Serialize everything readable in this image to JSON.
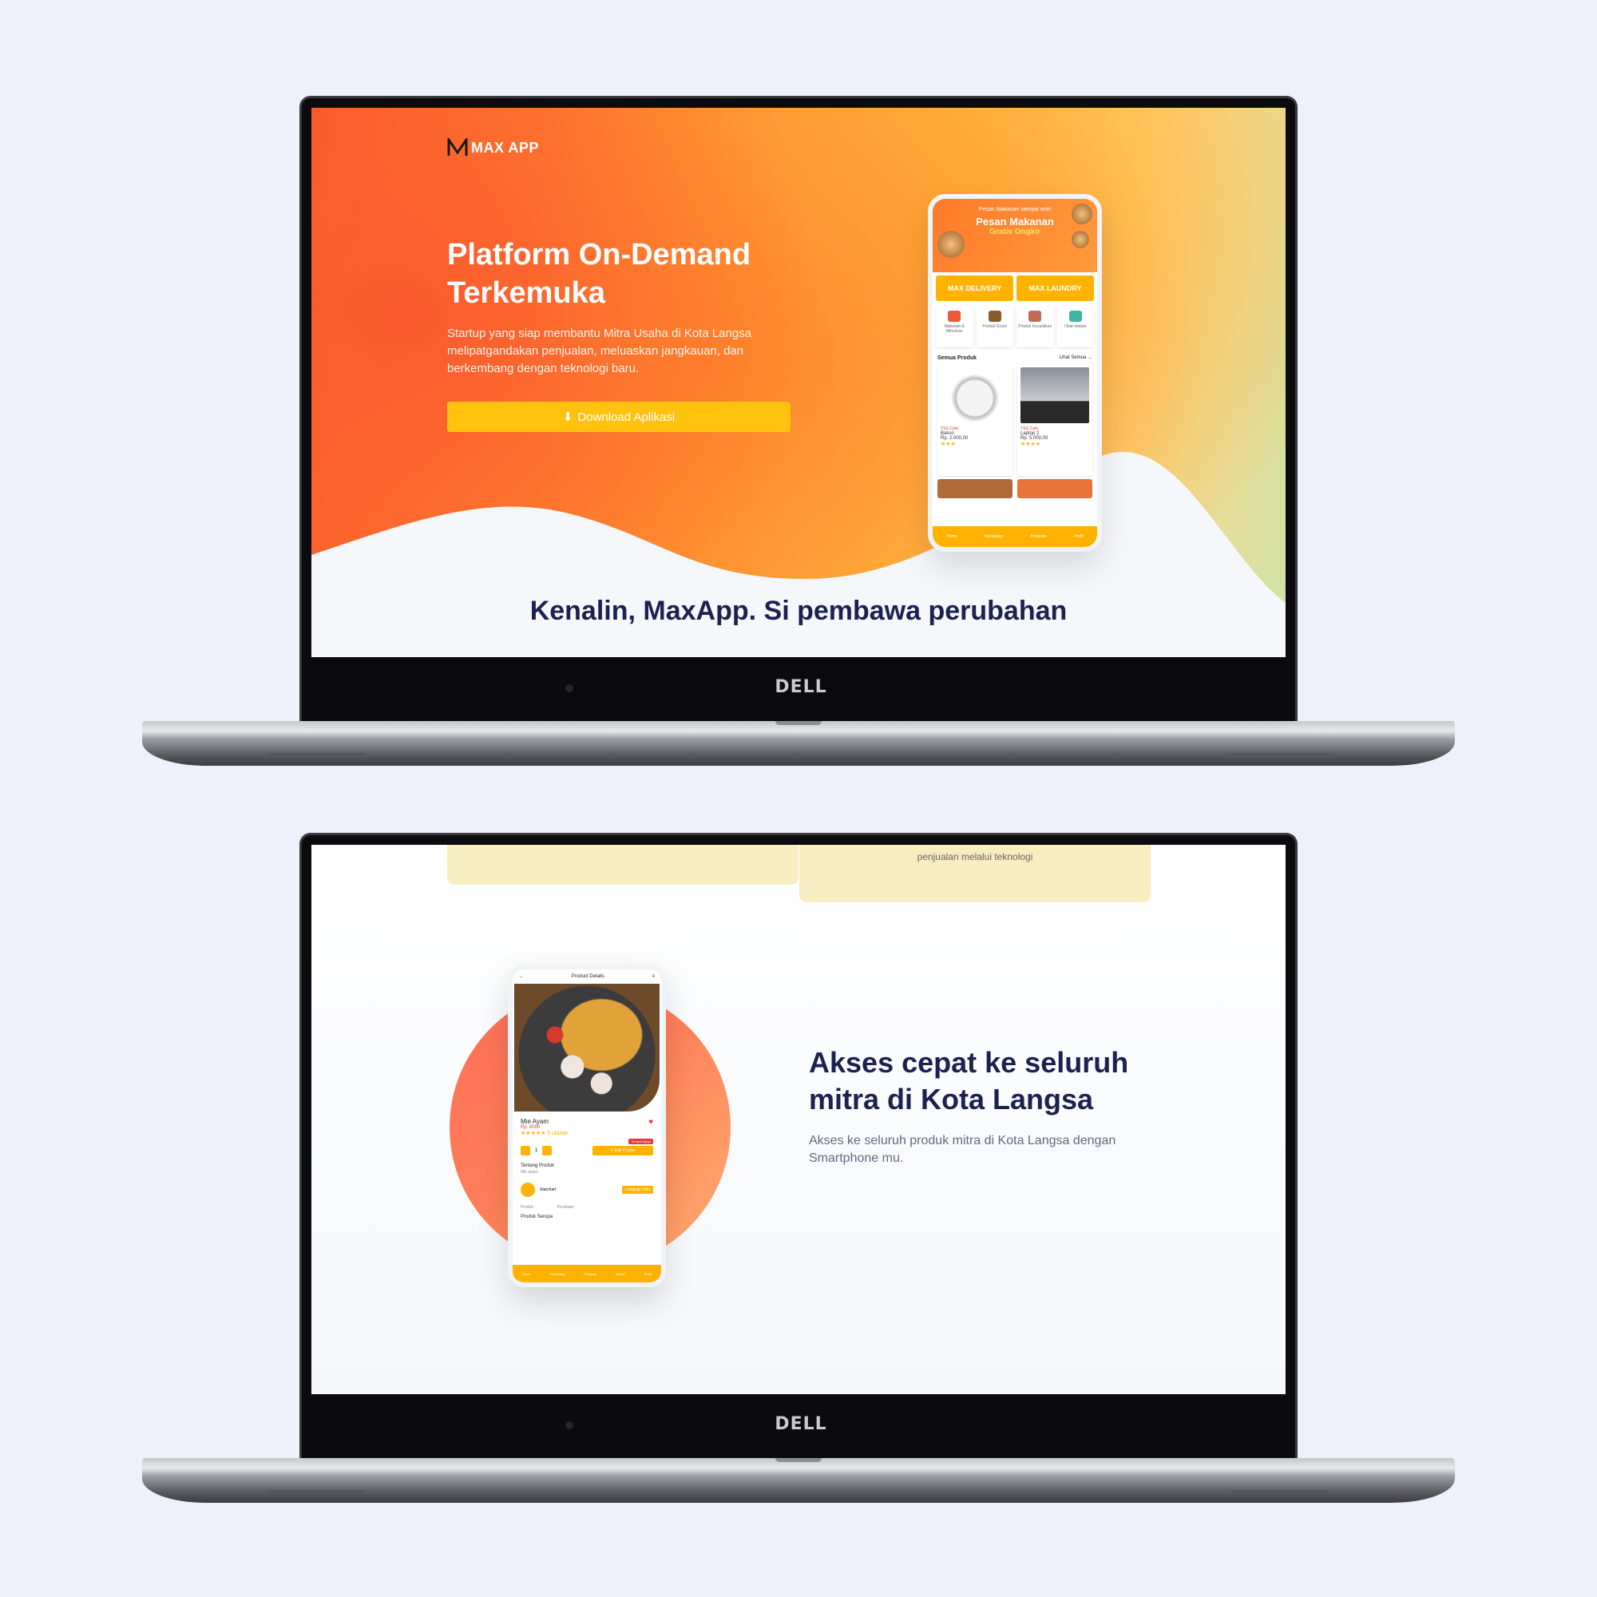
{
  "laptop": {
    "brand": "DELL"
  },
  "hero": {
    "logo_text": "MAX APP",
    "title": "Platform On-Demand Terkemuka",
    "subtitle": "Startup yang siap membantu Mitra Usaha di Kota Langsa melipatgandakan penjualan, meluaskan jangkauan, dan berkembang dengan teknologi baru.",
    "download_label": "Download Aplikasi",
    "section_heading": "Kenalin, MaxApp. Si pembawa perubahan"
  },
  "phone1": {
    "banner_small": "Pesan Makanan sampai antri",
    "banner_title": "Pesan Makanan",
    "banner_sub": "Gratis Ongkir",
    "services": [
      "MAX DELIVERY",
      "MAX LAUNDRY"
    ],
    "categories": [
      "Makanan & Minuman",
      "Produk Grosir",
      "Produk Kecantikan",
      "Obat obatan"
    ],
    "section_label": "Semua Produk",
    "see_all": "Lihat Semua →",
    "products": [
      {
        "shop": "TSG Cafe",
        "name": "Bakso",
        "price": "Rp. 2.000,00"
      },
      {
        "shop": "TSG Cafe",
        "name": "Laptop 2",
        "price": "Rp. 5.000,00"
      }
    ],
    "nav": [
      "Home",
      "Keranjang",
      "Pesanan",
      "Profil"
    ]
  },
  "section2": {
    "card_text": "penjualan melalui teknologi",
    "feature_title": "Akses cepat ke seluruh mitra di Kota Langsa",
    "feature_sub": "Akses ke seluruh produk mitra di Kota Langsa dengan Smartphone mu."
  },
  "phone2": {
    "header": "Product Details",
    "name": "Mie Ayam",
    "price": "Rp. 8000",
    "rating": "★★★★★ 5 ulasan",
    "badge": "Tempat Ngopi",
    "qty": "1",
    "edit_label": "✎ Edit Produk",
    "about_label": "Tentang Produk",
    "about_text": "Mie ayam",
    "seller_name": "Starchart",
    "chat_label": "Lengkap Toko",
    "stat1": "Produk",
    "stat2": "Penilaian",
    "similar_label": "Produk Serupa",
    "nav": [
      "Home",
      "Keranjang",
      "Pesanan",
      "Saved",
      "Profil"
    ]
  },
  "colors": {
    "accent": "#ffc20e",
    "brand_orange": "#fb5a2e",
    "heading": "#1c2150"
  }
}
